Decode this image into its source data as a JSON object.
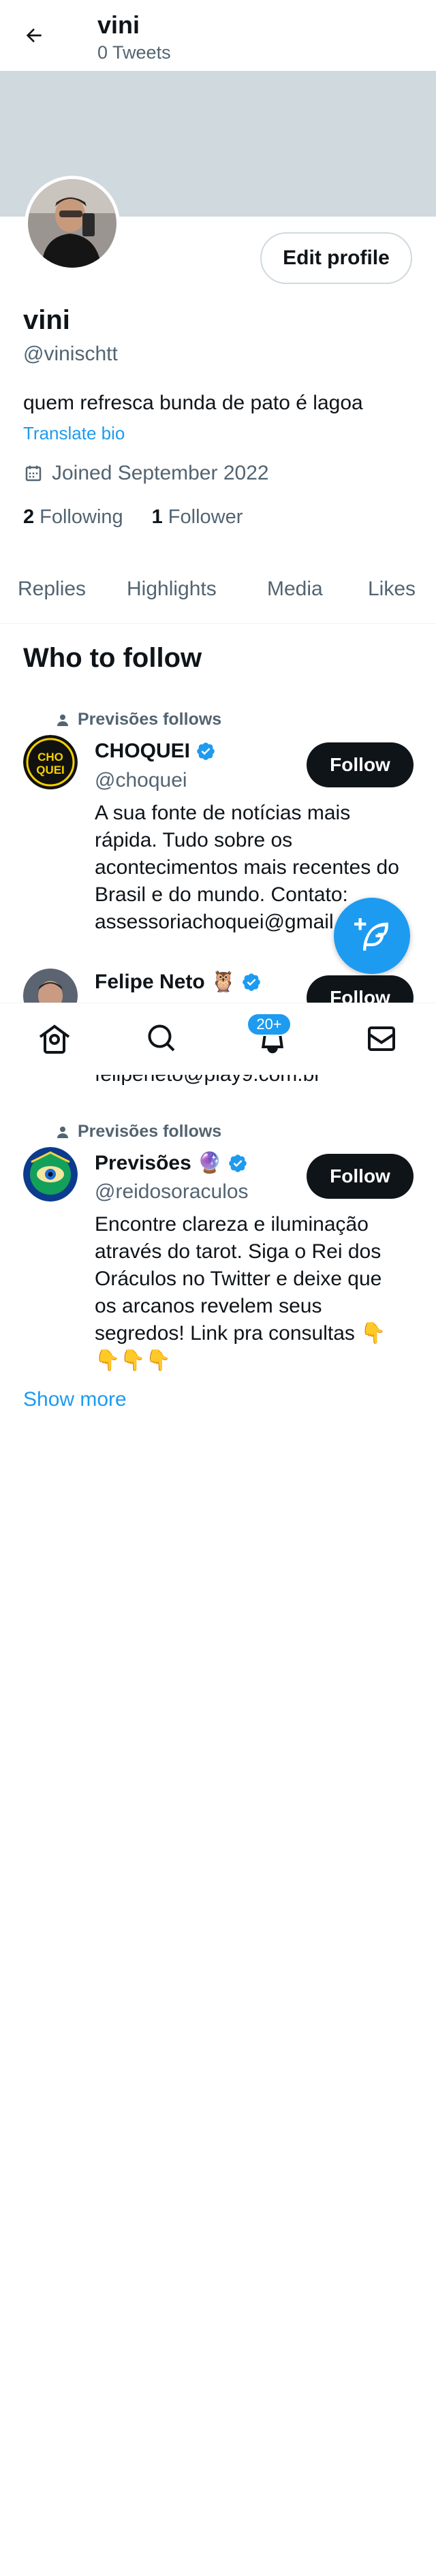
{
  "header": {
    "name": "vini",
    "tweet_count": "0 Tweets"
  },
  "profile": {
    "edit_label": "Edit profile",
    "name": "vini",
    "handle": "@vinischtt",
    "bio": "quem refresca bunda de pato é lagoa",
    "translate": "Translate bio",
    "joined": "Joined September 2022",
    "following_count": "2",
    "following_label": "Following",
    "followers_count": "1",
    "followers_label": "Follower"
  },
  "tabs": [
    {
      "label": "Replies"
    },
    {
      "label": "Highlights"
    },
    {
      "label": "Media"
    },
    {
      "label": "Likes"
    }
  ],
  "who_to_follow": {
    "title": "Who to follow",
    "follow_label": "Follow",
    "show_more": "Show more",
    "accounts": [
      {
        "note": "Previsões follows",
        "name": "CHOQUEI",
        "handle": "@choquei",
        "bio": "A sua fonte de notícias mais rápida. Tudo sobre os acontecimentos mais recentes do Brasil e do mundo. Contato: assessoriachoquei@gmail.c",
        "avatar_text": "CHO QUEI"
      },
      {
        "name": "Felipe Neto 🦉",
        "bio_tail": "felipeneto@play9.com.br"
      },
      {
        "note": "Previsões follows",
        "name": "Previsões 🔮",
        "handle": "@reidosoraculos",
        "bio": "Encontre clareza e iluminação através do tarot. Siga o Rei dos Oráculos no Twitter e deixe que os arcanos revelem seus segredos! Link pra consultas 👇👇👇👇"
      }
    ]
  },
  "bottom_nav": {
    "notifications_badge": "20+"
  },
  "colors": {
    "accent": "#1d9bf0",
    "text": "#0f1419",
    "muted": "#536471",
    "banner": "#cfd9de"
  }
}
